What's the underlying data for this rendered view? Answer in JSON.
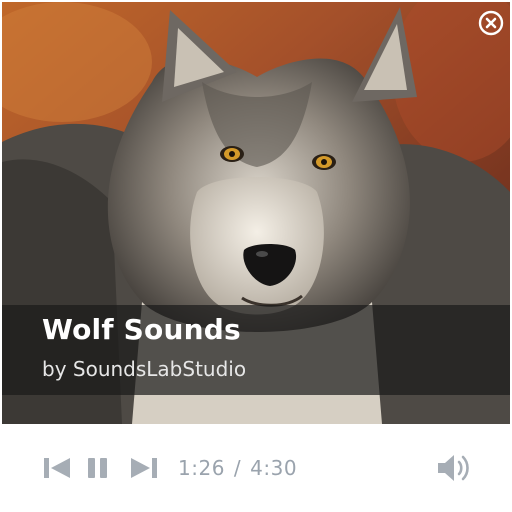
{
  "track": {
    "title": "Wolf Sounds",
    "artist": "by SoundsLabStudio"
  },
  "playback": {
    "current_time": "1:26",
    "separator": "/",
    "duration": "4:30",
    "state": "playing"
  },
  "icons": {
    "close": "close-circle-icon",
    "previous": "skip-previous-icon",
    "pause": "pause-icon",
    "next": "skip-next-icon",
    "volume": "volume-icon"
  },
  "colors": {
    "control_gray": "#a6adb5",
    "caption_bg": "#191919",
    "background": "#ffffff"
  }
}
